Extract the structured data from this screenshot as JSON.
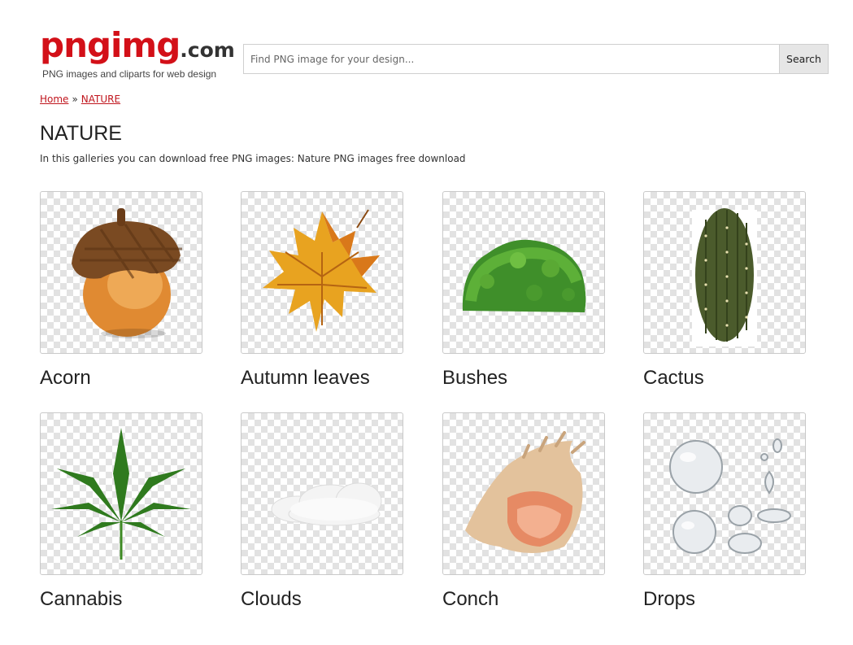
{
  "header": {
    "logo_main": "pngimg",
    "logo_tld": ".com",
    "tagline": "PNG images and cliparts for web design"
  },
  "search": {
    "placeholder": "Find PNG image for your design...",
    "button_label": "Search"
  },
  "breadcrumb": {
    "home": "Home",
    "separator": "»",
    "current": "NATURE"
  },
  "page": {
    "title": "NATURE",
    "intro": "In this galleries you can download free PNG images: Nature PNG images free download"
  },
  "gallery": {
    "items": [
      {
        "label": "Acorn",
        "icon": "acorn-icon"
      },
      {
        "label": "Autumn leaves",
        "icon": "maple-leaf-icon"
      },
      {
        "label": "Bushes",
        "icon": "bush-icon"
      },
      {
        "label": "Cactus",
        "icon": "cactus-icon"
      },
      {
        "label": "Cannabis",
        "icon": "cannabis-leaf-icon"
      },
      {
        "label": "Clouds",
        "icon": "cloud-icon"
      },
      {
        "label": "Conch",
        "icon": "conch-shell-icon"
      },
      {
        "label": "Drops",
        "icon": "water-drops-icon"
      }
    ]
  },
  "colors": {
    "brand_red": "#d31018",
    "link_red": "#c0151d"
  }
}
